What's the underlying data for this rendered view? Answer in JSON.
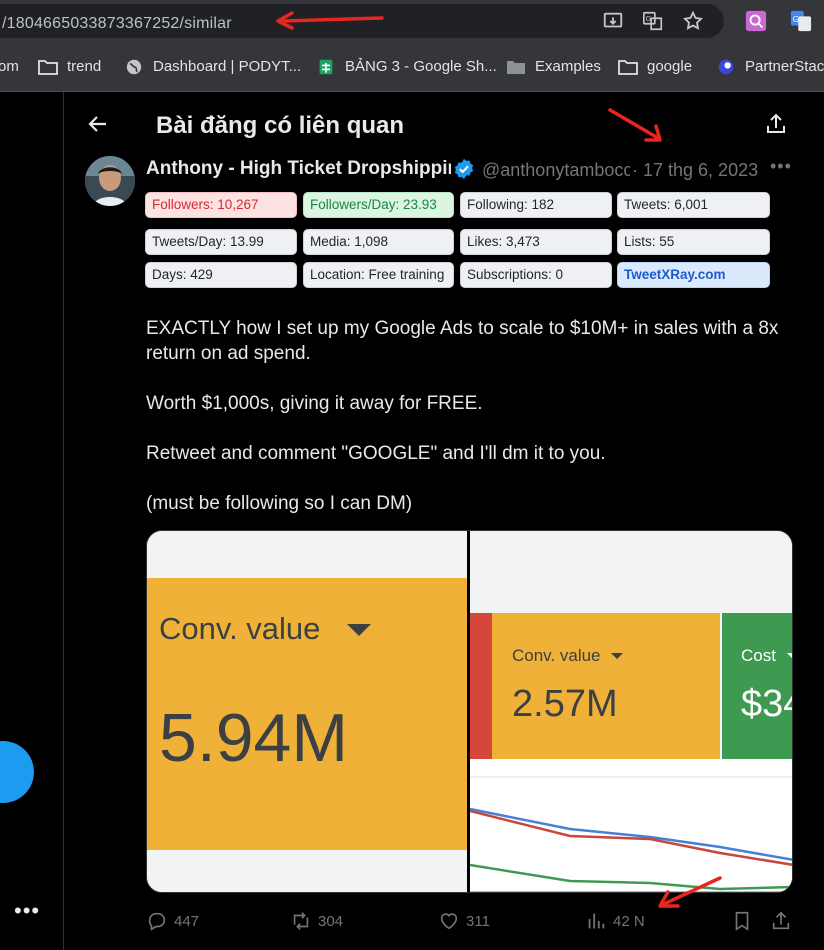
{
  "browser": {
    "url": "/1804665033873367252/similar",
    "bookmarks": [
      {
        "label": "om",
        "icon": "none"
      },
      {
        "label": "trend",
        "icon": "folder-icon"
      },
      {
        "label": "Dashboard | PODYT...",
        "icon": "globe-icon"
      },
      {
        "label": "BẢNG 3 - Google Sh...",
        "icon": "sheets-icon"
      },
      {
        "label": "Examples",
        "icon": "folder-icon"
      },
      {
        "label": "google",
        "icon": "folder-icon"
      },
      {
        "label": "PartnerStack",
        "icon": "partnerstack-icon"
      }
    ]
  },
  "header": {
    "title": "Bài đăng có liên quan"
  },
  "post": {
    "author_name": "Anthony - High Ticket Dropshipping",
    "handle": "@anthonytambocc",
    "separator": "·",
    "date": "17 thg 6, 2023",
    "stats": {
      "followers": "Followers: 10,267",
      "followers_per_day": "Followers/Day: 23.93",
      "following": "Following: 182",
      "tweets": "Tweets: 6,001",
      "tweets_per_day": "Tweets/Day: 13.99",
      "media": "Media: 1,098",
      "likes": "Likes: 3,473",
      "lists": "Lists: 55",
      "days": "Days: 429",
      "location": "Location: Free training",
      "subscriptions": "Subscriptions: 0",
      "tweetxray": "TweetXRay.com"
    },
    "text": [
      "EXACTLY how I set up my Google Ads to scale to $10M+ in sales with a 8x return on ad spend.",
      "Worth $1,000s, giving it away for FREE.",
      "Retweet and comment \"GOOGLE\" and I'll dm it to you.",
      "(must be following so I can DM)"
    ],
    "media": {
      "left_label": "Conv. value",
      "left_value": "5.94M",
      "right_label": "Conv. value",
      "right_value": "2.57M",
      "right_label2": "Cost",
      "right_value2": "$34"
    },
    "actions": {
      "replies": "447",
      "reposts": "304",
      "likes": "311",
      "views": "42 N"
    }
  },
  "colors": {
    "accent": "#1d9bf0",
    "annotation": "#e8261f"
  }
}
